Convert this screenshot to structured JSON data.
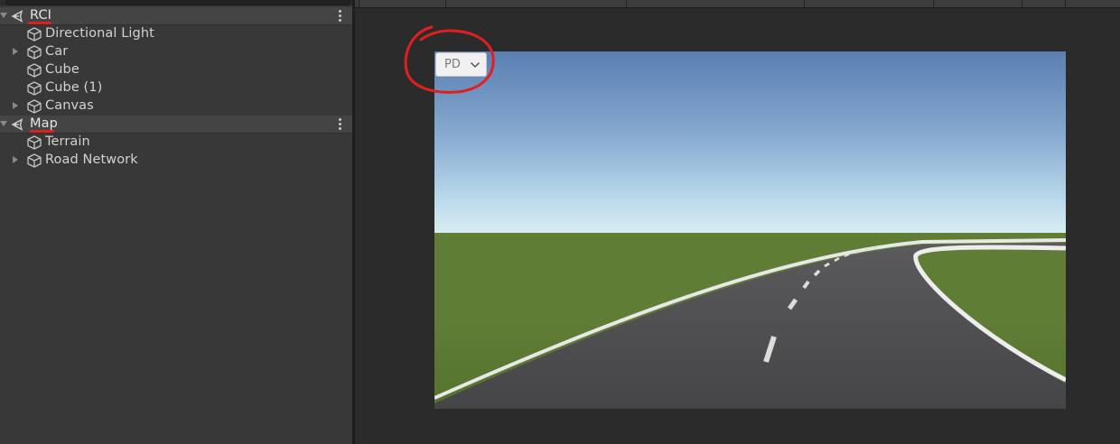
{
  "hierarchy": {
    "scenes": [
      {
        "name": "RCI",
        "objects": [
          {
            "name": "Directional Light",
            "expandable": false
          },
          {
            "name": "Car",
            "expandable": true
          },
          {
            "name": "Cube",
            "expandable": false
          },
          {
            "name": "Cube (1)",
            "expandable": false
          },
          {
            "name": "Canvas",
            "expandable": true
          }
        ]
      },
      {
        "name": "Map",
        "objects": [
          {
            "name": "Terrain",
            "expandable": false
          },
          {
            "name": "Road Network",
            "expandable": true
          }
        ]
      }
    ]
  },
  "game_view": {
    "dropdown": {
      "value": "PD"
    }
  },
  "annotations": {
    "color": "#e0201f",
    "underlined_labels": [
      "RCI",
      "Map"
    ],
    "circled_element": "dropdown"
  },
  "colors": {
    "panel_bg": "#383838",
    "scene_row_bg": "#444444",
    "text": "#d2d2d2",
    "sky_top": "#5a7fb2",
    "sky_horizon": "#d4ecf3",
    "grass": "#5a7a32",
    "road": "#4a4a4c"
  }
}
